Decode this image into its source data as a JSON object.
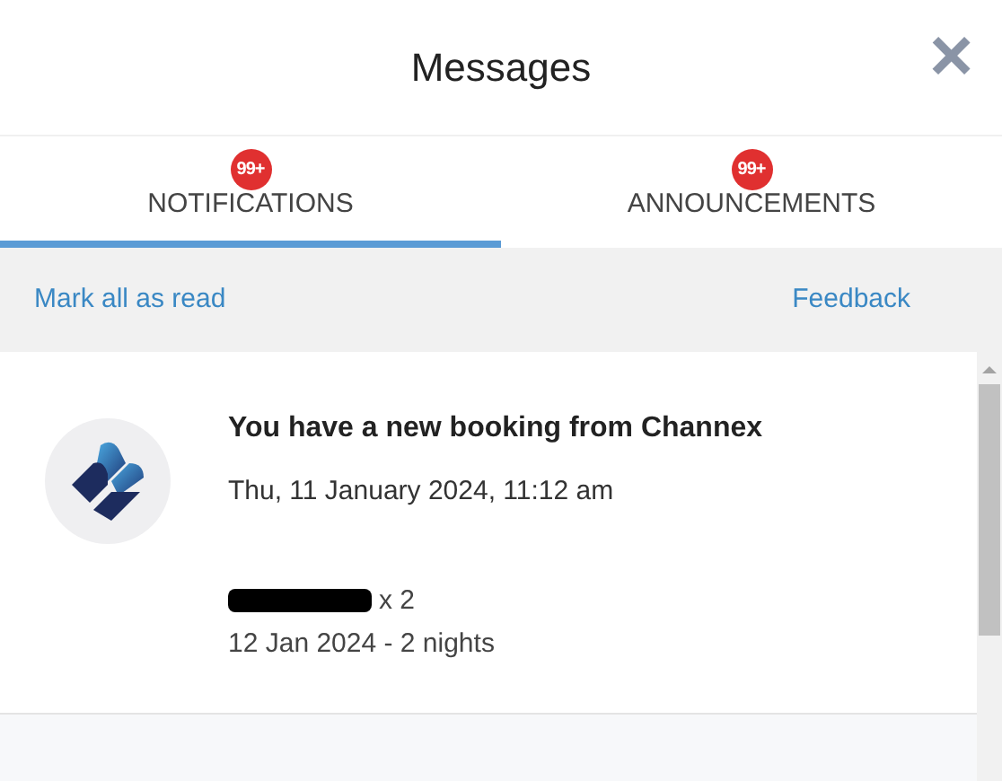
{
  "header": {
    "title": "Messages",
    "close": "×"
  },
  "tabs": [
    {
      "label": "NOTIFICATIONS",
      "badge": "99+",
      "selected": true
    },
    {
      "label": "ANNOUNCEMENTS",
      "badge": "99+",
      "selected": false
    }
  ],
  "actions": {
    "mark_all": "Mark all as read",
    "feedback": "Feedback"
  },
  "messages": [
    {
      "title": "You have a new booking from Channex",
      "time": "Thu, 11 January 2024, 11:12 am",
      "guest_redacted": true,
      "quantity": "x 2",
      "stay": "12 Jan 2024 - 2 nights",
      "read": true
    }
  ]
}
